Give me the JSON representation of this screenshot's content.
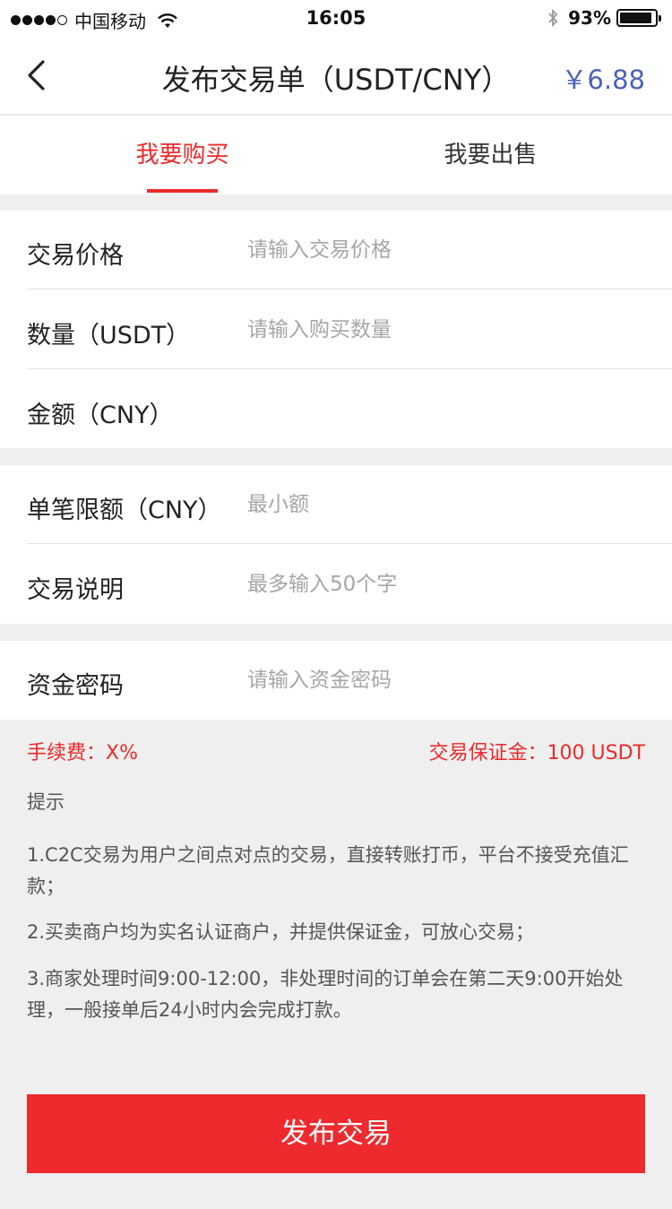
{
  "status_bar": {
    "carrier": "中国移动",
    "time": "16:05",
    "battery": "93%",
    "battery_level": 0.93,
    "icons": [
      "signal-dots-icon",
      "wifi-icon",
      "bluetooth-icon",
      "battery-icon"
    ]
  },
  "nav": {
    "back_icon": "chevron-left-icon",
    "title": "发布交易单（USDT/CNY）",
    "price": "￥6.88",
    "price_color": "#4a63b5"
  },
  "tabs": [
    {
      "label": "我要购买",
      "active": true
    },
    {
      "label": "我要出售",
      "active": false
    }
  ],
  "accent_color": "#ec2a2a",
  "form": {
    "group1": [
      {
        "label": "交易价格",
        "placeholder": "请输入交易价格",
        "value": ""
      },
      {
        "label": "数量（USDT）",
        "placeholder": "请输入购买数量",
        "value": ""
      },
      {
        "label": "金额（CNY）",
        "placeholder": "",
        "value": ""
      }
    ],
    "group2": [
      {
        "label": "单笔限额（CNY）",
        "placeholder": "最小额",
        "value": ""
      },
      {
        "label": "交易说明",
        "placeholder": "最多输入50个字",
        "value": ""
      }
    ],
    "group3": [
      {
        "label": "资金密码",
        "placeholder": "请输入资金密码",
        "value": ""
      }
    ]
  },
  "fees": {
    "fee": "手续费：X%",
    "deposit": "交易保证金：100 USDT"
  },
  "tips": {
    "title": "提示",
    "items": [
      "1.C2C交易为用户之间点对点的交易，直接转账打币，平台不接受充值汇款；",
      "2.买卖商户均为实名认证商户，并提供保证金，可放心交易；",
      "3.商家处理时间9:00-12:00，非处理时间的订单会在第二天9:00开始处理，一般接单后24小时内会完成打款。"
    ]
  },
  "submit_label": "发布交易"
}
